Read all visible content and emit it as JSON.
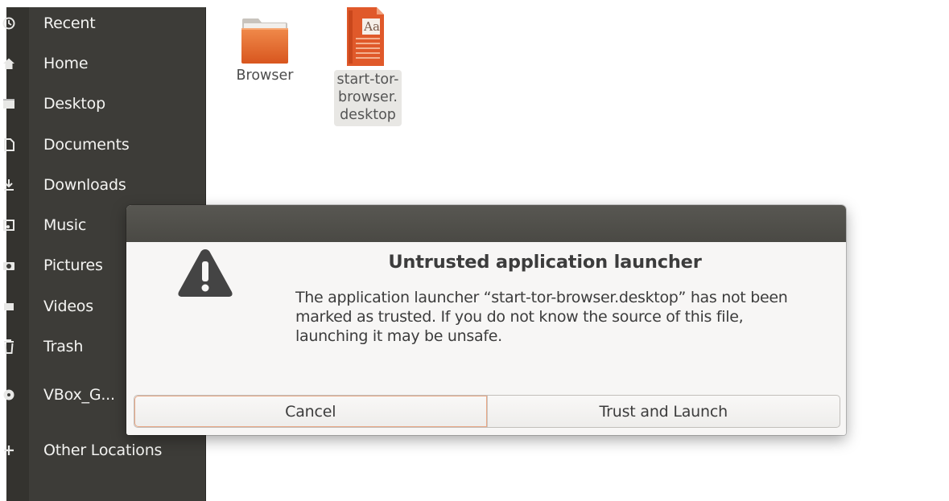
{
  "sidebar": {
    "items": [
      {
        "label": "Recent",
        "icon": "clock-icon"
      },
      {
        "label": "Home",
        "icon": "home-icon"
      },
      {
        "label": "Desktop",
        "icon": "desktop-icon"
      },
      {
        "label": "Documents",
        "icon": "document-icon"
      },
      {
        "label": "Downloads",
        "icon": "download-icon"
      },
      {
        "label": "Music",
        "icon": "music-icon"
      },
      {
        "label": "Pictures",
        "icon": "camera-icon"
      },
      {
        "label": "Videos",
        "icon": "video-icon"
      },
      {
        "label": "Trash",
        "icon": "trash-icon"
      },
      {
        "label": "VBox_G...",
        "icon": "disc-icon"
      },
      {
        "label": "Other Locations",
        "icon": "plus-icon"
      }
    ]
  },
  "files": [
    {
      "label": "Browser",
      "icon": "folder-icon"
    },
    {
      "label_lines": [
        "start-tor-",
        "browser.",
        "desktop"
      ],
      "icon": "text-file-icon",
      "icon_text": "Aa",
      "selected": true
    }
  ],
  "dialog": {
    "title": "Untrusted application launcher",
    "message_lines": [
      "The application launcher “start-tor-browser.desktop” has not been",
      "marked as trusted. If you do not know the source of this file,",
      "launching it may be unsafe."
    ],
    "icon": "warning-icon",
    "buttons": {
      "cancel": "Cancel",
      "trust": "Trust and Launch"
    }
  },
  "colors": {
    "sidebar_bg": "#3d3c38",
    "accent_orange": "#e95420",
    "folder_orange": "#e2692f",
    "dialog_bg": "#f7f6f5",
    "titlebar": "#4f4e49"
  }
}
